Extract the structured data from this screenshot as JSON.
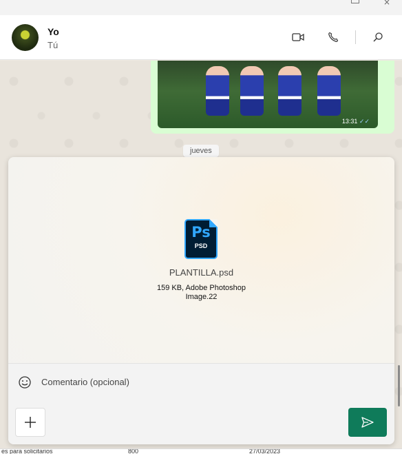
{
  "header": {
    "contact_name": "Yo",
    "contact_sub": "Tú",
    "icons": [
      "video-call-icon",
      "voice-call-icon",
      "search-icon"
    ]
  },
  "chat": {
    "photo_time": "13:31",
    "date_chip": "jueves"
  },
  "attachment": {
    "icon_label": "Ps",
    "icon_ext": "PSD",
    "file_name": "PLANTILLA.psd",
    "file_meta_line1": "159 KB, Adobe Photoshop",
    "file_meta_line2": "Image.22",
    "comment_placeholder": "Comentario (opcional)"
  },
  "underlying": {
    "cell1": "es para solicitarios",
    "cell2": "800",
    "cell3": "27/03/2023"
  },
  "colors": {
    "accent": "#0f7b5a",
    "ps_blue": "#31a8ff",
    "bubble": "#d9fdd3"
  }
}
